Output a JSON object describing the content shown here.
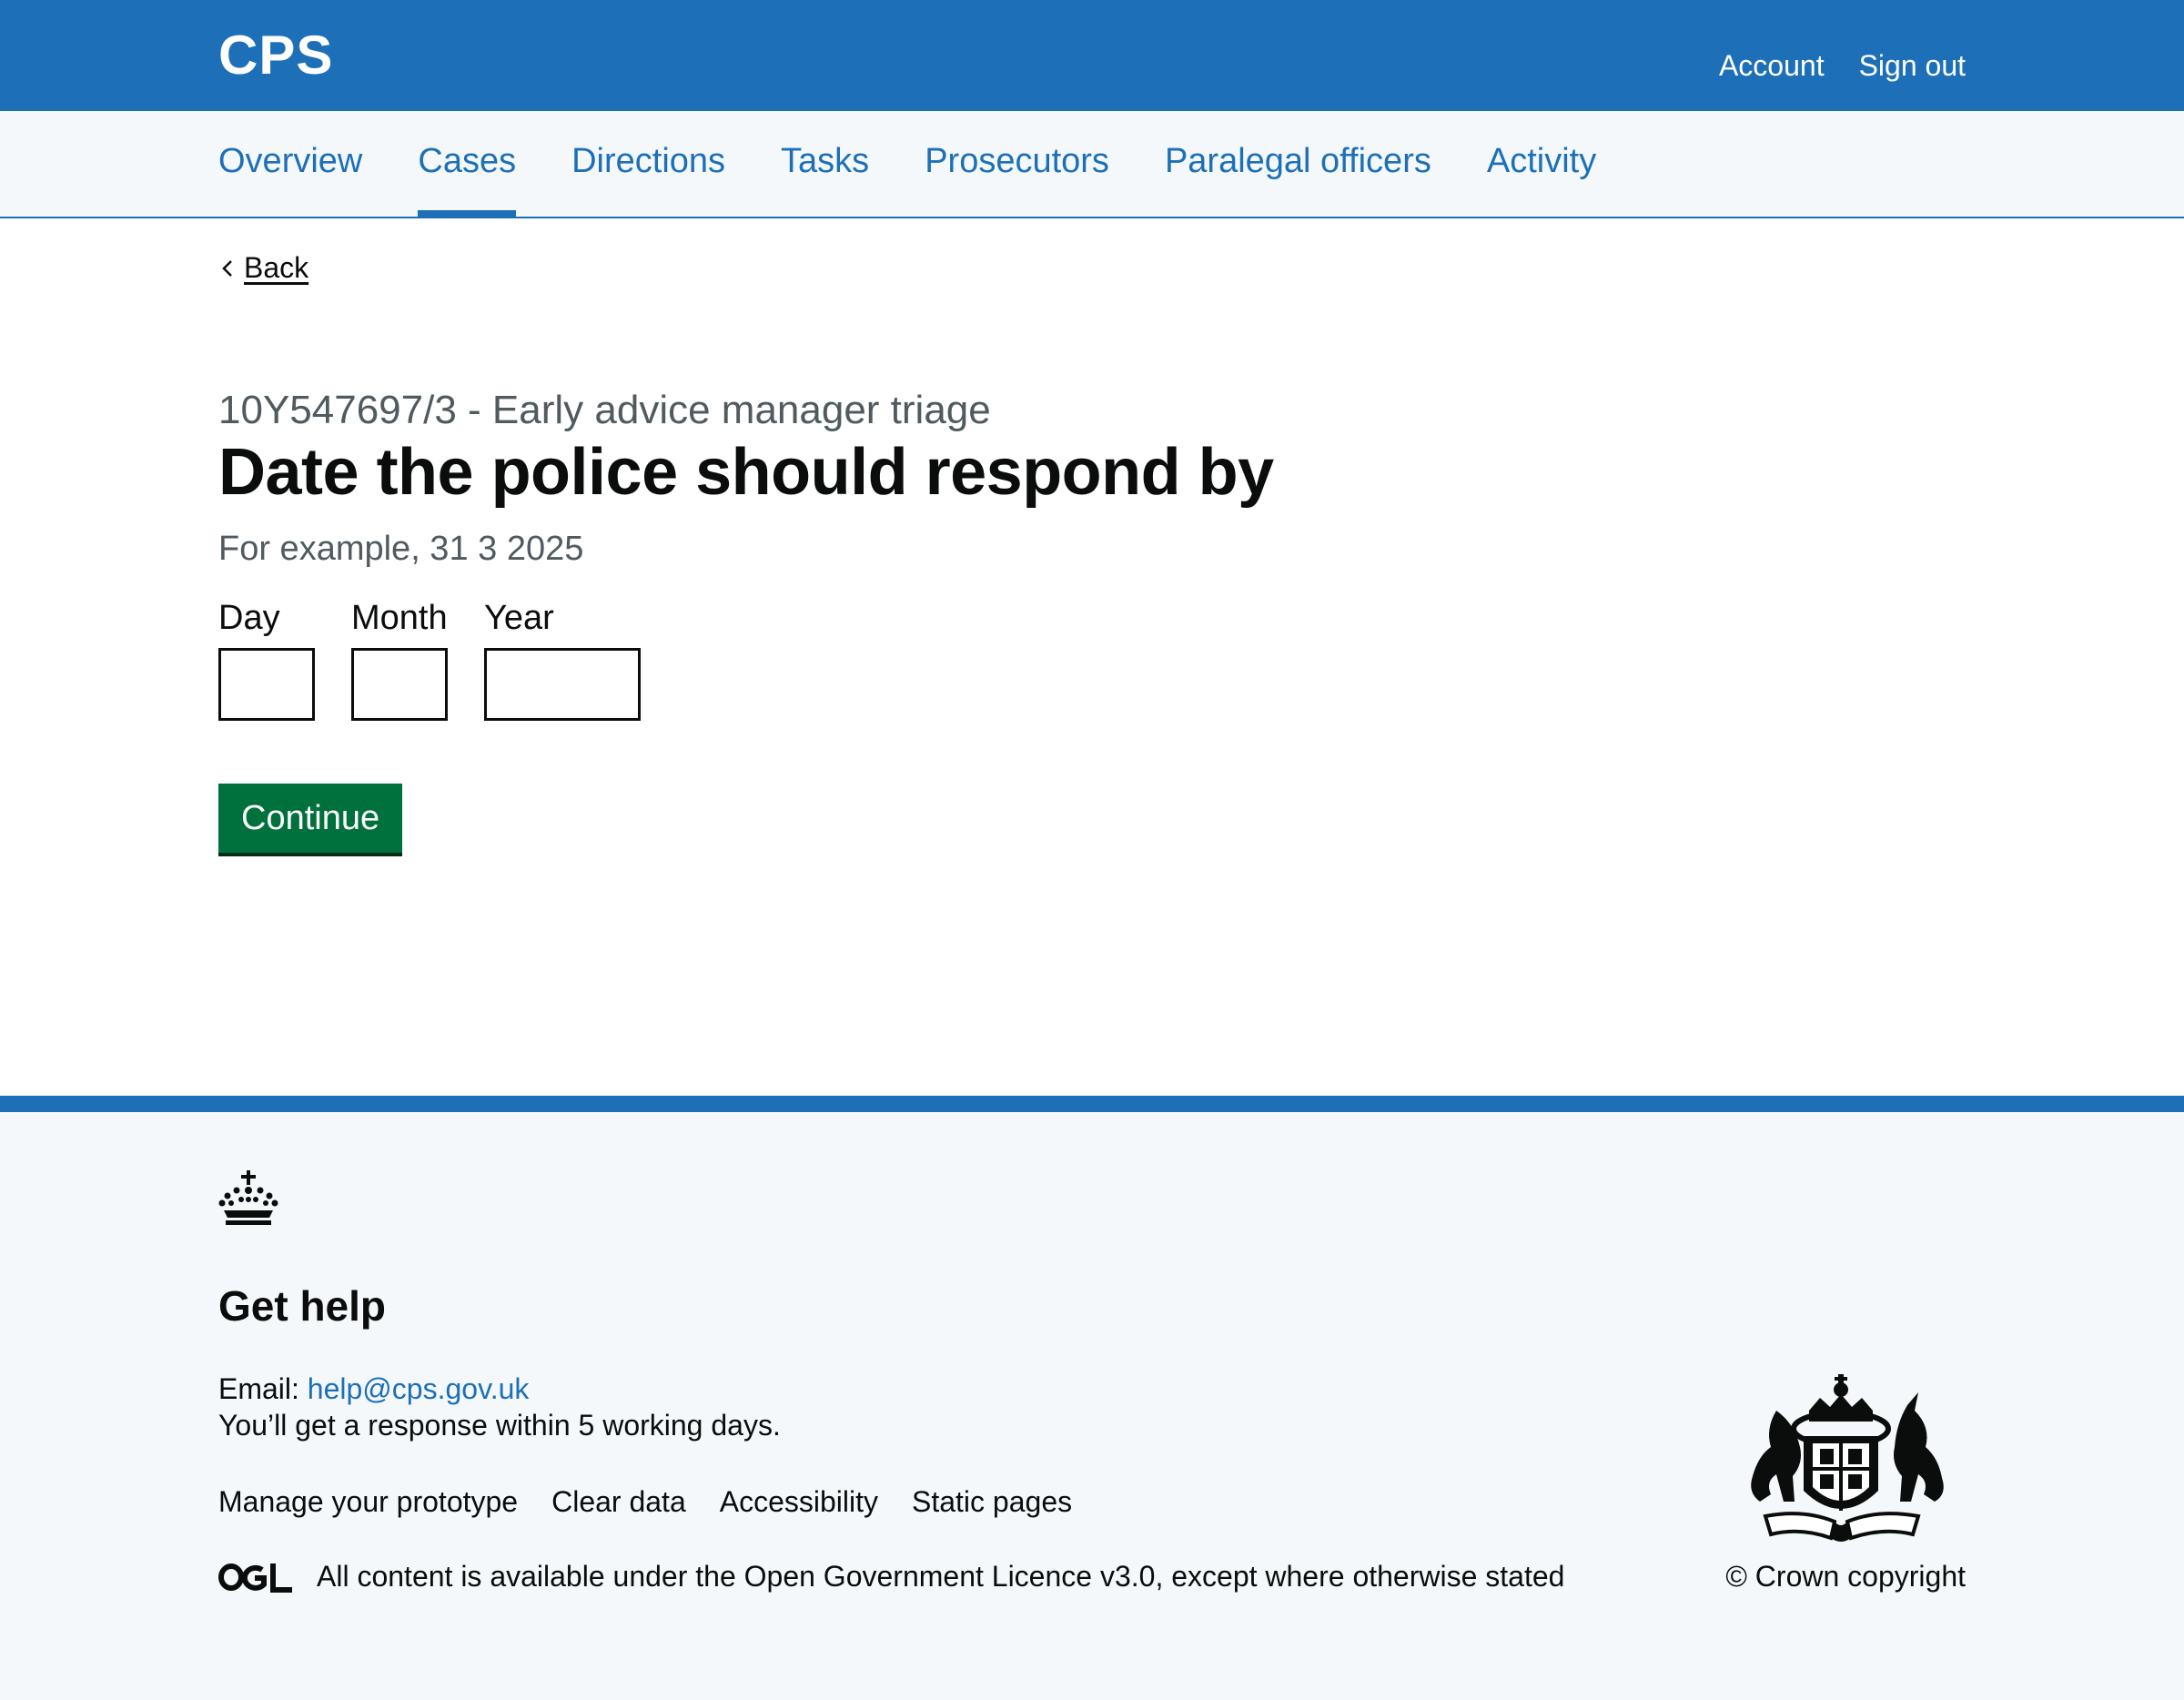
{
  "header": {
    "logo": "CPS",
    "nav": [
      "Account",
      "Sign out"
    ]
  },
  "service_nav": {
    "items": [
      "Overview",
      "Cases",
      "Directions",
      "Tasks",
      "Prosecutors",
      "Paralegal officers",
      "Activity"
    ],
    "active": "Cases"
  },
  "main": {
    "back_label": "Back",
    "caption": "10Y547697/3 - Early advice manager triage",
    "heading": "Date the police should respond by",
    "hint": "For example, 31 3 2025",
    "date_fields": {
      "day_label": "Day",
      "month_label": "Month",
      "year_label": "Year",
      "day_value": "",
      "month_value": "",
      "year_value": ""
    },
    "continue_label": "Continue"
  },
  "footer": {
    "help_heading": "Get help",
    "email_prefix": "Email: ",
    "email": "help@cps.gov.uk",
    "response_text": "You’ll get a response within 5 working days.",
    "links": [
      "Manage your prototype",
      "Clear data",
      "Accessibility",
      "Static pages"
    ],
    "licence_prefix": "All content is available under the ",
    "licence_link": "Open Government Licence v3.0",
    "licence_suffix": ", except where otherwise stated",
    "copyright": "© Crown copyright",
    "logo_icons": [
      "crown-icon",
      "ogl-logo-icon",
      "royal-coat-of-arms-icon"
    ]
  },
  "colors": {
    "brand_blue": "#1d70b8",
    "button_green": "#00703c",
    "text": "#0b0c0c",
    "secondary_text": "#505a5f",
    "footer_bg": "#f4f8fb",
    "service_nav_bg": "#f4f8fb"
  }
}
